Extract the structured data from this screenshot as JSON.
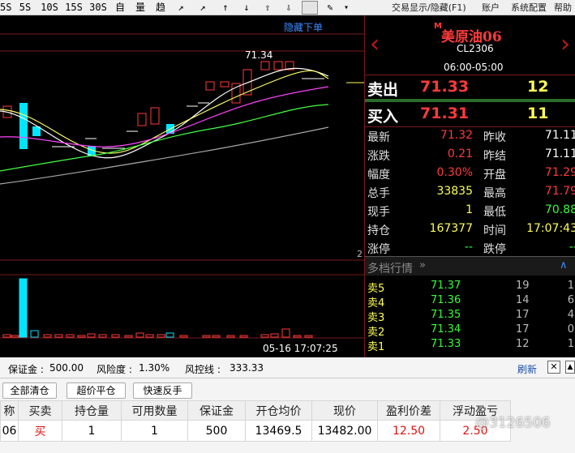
{
  "toolbar": {
    "icons": [
      "5S",
      "10S",
      "15S",
      "30S",
      "自",
      "量",
      "趋",
      "↗",
      "↑",
      "↓",
      "⇧",
      "⇩",
      "✎"
    ],
    "menu": [
      "交易显示/隐藏(F1)",
      "账户",
      "系统配置",
      "帮助"
    ],
    "pencil_dropdown": "▾"
  },
  "chart": {
    "hide_order_label": "隐藏下单",
    "high_label": "71.34",
    "timestamp": "05-16 17:07:25",
    "pane_number": "2",
    "colors": {
      "up": "#ff3a3a",
      "down": "#00e5ff",
      "ma5": "#ffffff",
      "ma10": "#ffff66",
      "ma20": "#ff44ff",
      "ma40": "#44ff44",
      "ma60": "#aaaaaa",
      "volume": "#00e5ff"
    }
  },
  "quote": {
    "badge": "M",
    "name": "美原油06",
    "code": "CL2306",
    "session": "06:00-05:00",
    "sell_label": "卖出",
    "sell_price": "71.33",
    "sell_qty": "12",
    "buy_label": "买入",
    "buy_price": "71.31",
    "buy_qty": "11",
    "fields": [
      {
        "l1": "最新",
        "v1": "71.32",
        "c1": "#ff3a3a",
        "l2": "昨收",
        "v2": "71.11",
        "c2": "#ffffff"
      },
      {
        "l1": "涨跌",
        "v1": "0.21",
        "c1": "#ff3a3a",
        "l2": "昨结",
        "v2": "71.11",
        "c2": "#ffffff"
      },
      {
        "l1": "幅度",
        "v1": "0.30%",
        "c1": "#ff3a3a",
        "l2": "开盘",
        "v2": "71.29",
        "c2": "#ff3a3a"
      },
      {
        "l1": "总手",
        "v1": "33835",
        "c1": "#ffff55",
        "l2": "最高",
        "v2": "71.79",
        "c2": "#ff3a3a"
      },
      {
        "l1": "现手",
        "v1": "1",
        "c1": "#ffff55",
        "l2": "最低",
        "v2": "70.88",
        "c2": "#33ff33"
      },
      {
        "l1": "持仓",
        "v1": "167377",
        "c1": "#ffff55",
        "l2": "时间",
        "v2": "17:07:43",
        "c2": "#ffff55"
      },
      {
        "l1": "涨停",
        "v1": "--",
        "c1": "#33ff33",
        "l2": "跌停",
        "v2": "--",
        "c2": "#33ff33"
      }
    ],
    "depth_title": "多档行情",
    "depth": [
      {
        "label": "卖5",
        "price": "71.37",
        "qty": "19",
        "extra": "1"
      },
      {
        "label": "卖4",
        "price": "71.36",
        "qty": "14",
        "extra": "6"
      },
      {
        "label": "卖3",
        "price": "71.35",
        "qty": "17",
        "extra": "4"
      },
      {
        "label": "卖2",
        "price": "71.34",
        "qty": "17",
        "extra": "0"
      },
      {
        "label": "卖1",
        "price": "71.33",
        "qty": "12",
        "extra": "1"
      }
    ]
  },
  "account": {
    "margin_label": "保证金 :",
    "margin_value": "500.00",
    "risk_label": "风险度 :",
    "risk_value": "1.30%",
    "stopline_label": "风控线 :",
    "stopline_value": "333.33",
    "refresh": "刷新"
  },
  "actions": [
    "全部清仓",
    "超价平仓",
    "快速反手"
  ],
  "positions": {
    "headers": [
      "称",
      "买卖",
      "持仓量",
      "可用数量",
      "保证金",
      "开仓均价",
      "现价",
      "盈利价差",
      "浮动盈亏"
    ],
    "rows": [
      [
        "06",
        "买",
        "1",
        "1",
        "500",
        "13469.5",
        "13482.00",
        "12.50",
        "2.50"
      ]
    ]
  },
  "watermark": "@3126506"
}
